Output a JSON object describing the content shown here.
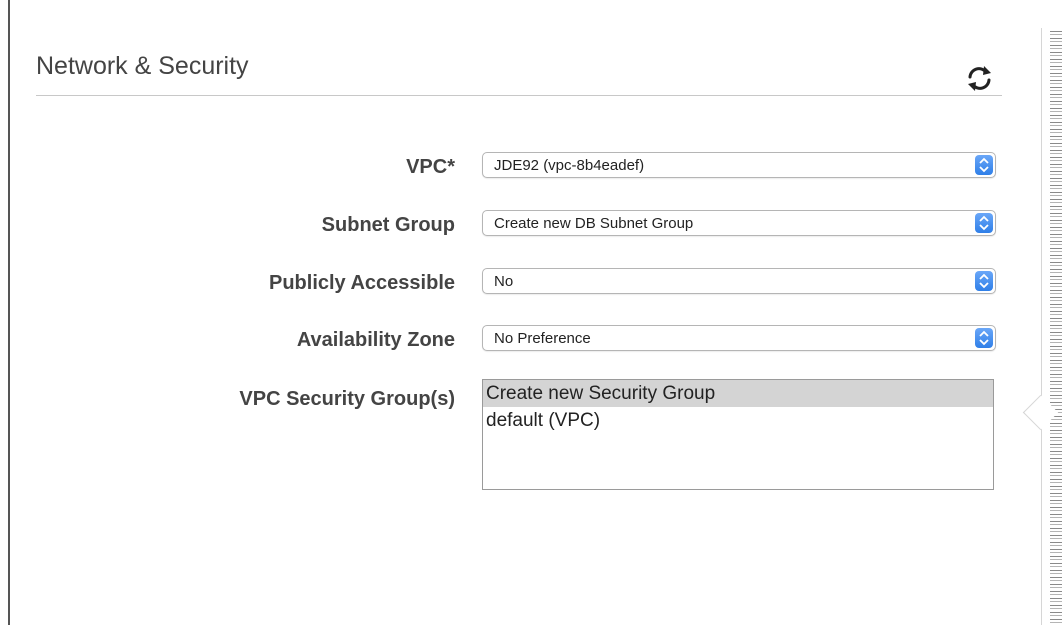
{
  "section": {
    "title": "Network & Security"
  },
  "toolbar": {
    "refresh_icon": "refresh-icon"
  },
  "fields": {
    "vpc": {
      "label": "VPC*",
      "value": "JDE92 (vpc-8b4eadef)"
    },
    "subnet_group": {
      "label": "Subnet Group",
      "value": "Create new DB Subnet Group"
    },
    "publicly_accessible": {
      "label": "Publicly Accessible",
      "value": "No"
    },
    "availability_zone": {
      "label": "Availability Zone",
      "value": "No Preference"
    },
    "security_groups": {
      "label": "VPC Security Group(s)",
      "options": [
        {
          "label": "Create new Security Group",
          "selected": true
        },
        {
          "label": "default (VPC)",
          "selected": false
        }
      ]
    }
  },
  "colors": {
    "select_arrow": "#2f7fe8",
    "selected_option_bg": "#d4d4d4",
    "label_text": "#444444"
  }
}
